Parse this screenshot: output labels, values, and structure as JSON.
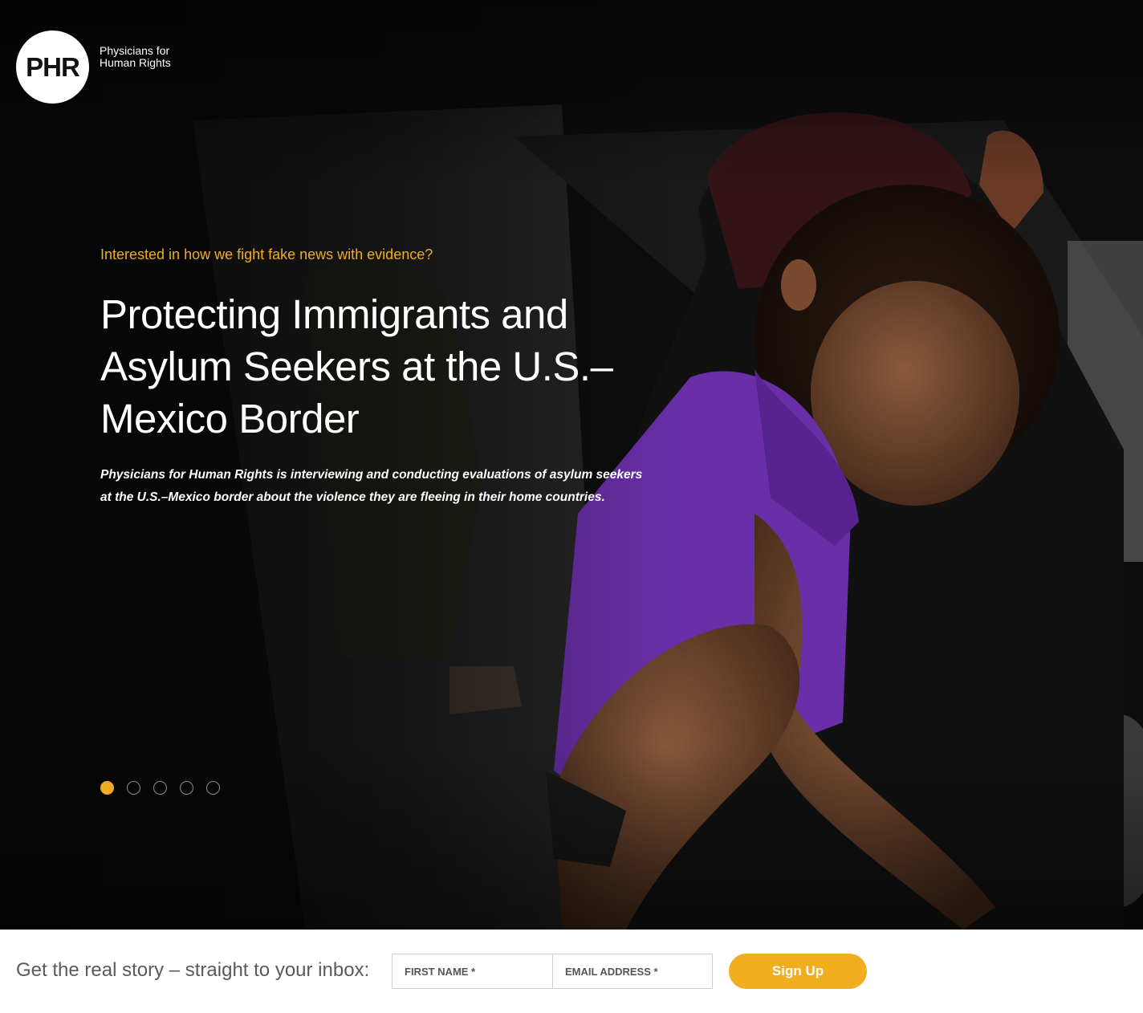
{
  "logo": {
    "mark": "PHR",
    "line1": "Physicians for",
    "line2": "Human Rights"
  },
  "hero": {
    "eyebrow": "Interested in how we fight fake news with evidence?",
    "headline": "Protecting Immigrants and Asylum Seekers at the U.S.–Mexico Border",
    "lede": "Physicians for Human Rights is interviewing and conducting evaluations of asylum seekers at the U.S.–Mexico border about the violence they are fleeing in their home countries.",
    "slides_total": 5,
    "active_slide": 1
  },
  "signup": {
    "label": "Get the real story – straight to your inbox:",
    "first_name_placeholder": "FIRST NAME *",
    "email_placeholder": "EMAIL ADDRESS *",
    "button_label": "Sign Up"
  },
  "colors": {
    "accent": "#f0ad1e",
    "hero_bg": "#0b0b0b",
    "shirt": "#6a2fa8"
  }
}
